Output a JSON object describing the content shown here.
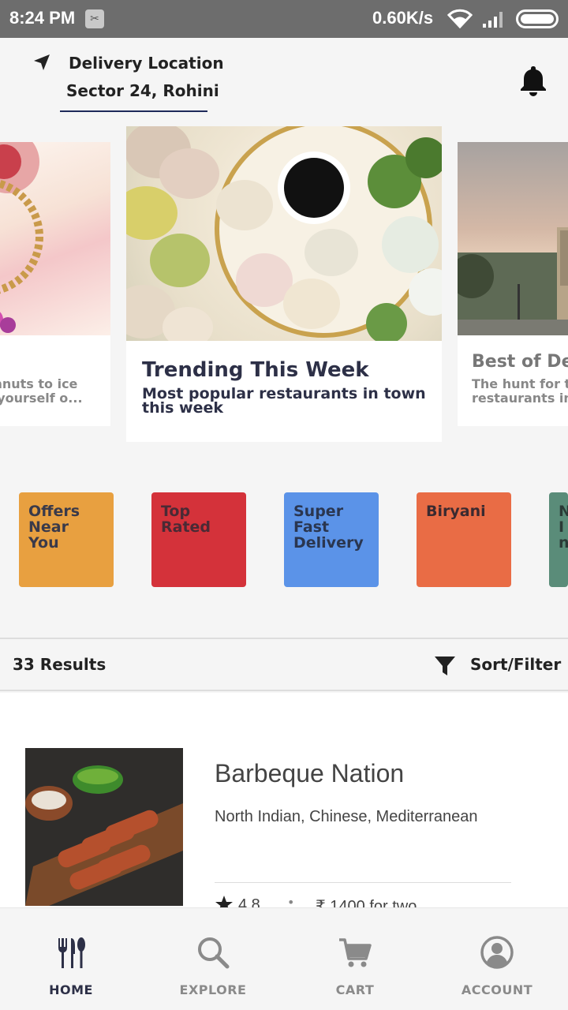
{
  "status_bar": {
    "time": "8:24 PM",
    "network_speed": "0.60K/s"
  },
  "header": {
    "location_label": "Delivery Location",
    "location_value": "Sector 24, Rohini",
    "accent_color": "#1e2a5a"
  },
  "carousel": {
    "left_card": {
      "subtitle_line1": "ghnuts to ice",
      "subtitle_line2": "k yourself o..."
    },
    "center_card": {
      "title": "Trending This Week",
      "subtitle": "Most popular restaurants in town this week"
    },
    "right_card": {
      "title": "Best of De",
      "subtitle_line1": "The hunt for t",
      "subtitle_line2": "restaurants in"
    }
  },
  "categories": [
    {
      "label": "Offers Near You",
      "color": "#e8a040",
      "text_color": "#3a3a4a"
    },
    {
      "label": "Top Rated",
      "color": "#d4323a",
      "text_color": "#4a2a35"
    },
    {
      "label": "Super Fast Delivery",
      "color": "#5b93e8",
      "text_color": "#2a3650"
    },
    {
      "label": "Biryani",
      "color": "#e96c45",
      "text_color": "#3a2a30"
    },
    {
      "label": "N In",
      "color": "#5a8c79",
      "text_color": "#2a3a36"
    }
  ],
  "results": {
    "count_label": "33 Results",
    "sort_label": "Sort/Filter"
  },
  "restaurants": [
    {
      "name": "Barbeque Nation",
      "cuisine": "North Indian, Chinese, Mediterranean",
      "rating": "4.8",
      "separator": "•",
      "price": "₹ 1400 for two"
    }
  ],
  "nav": {
    "items": [
      {
        "label": "HOME",
        "icon": "cutlery-icon",
        "active": true
      },
      {
        "label": "EXPLORE",
        "icon": "search-icon",
        "active": false
      },
      {
        "label": "CART",
        "icon": "cart-icon",
        "active": false
      },
      {
        "label": "ACCOUNT",
        "icon": "account-icon",
        "active": false
      }
    ],
    "active_color": "#2d3047",
    "inactive_color": "#8a8a8a"
  }
}
